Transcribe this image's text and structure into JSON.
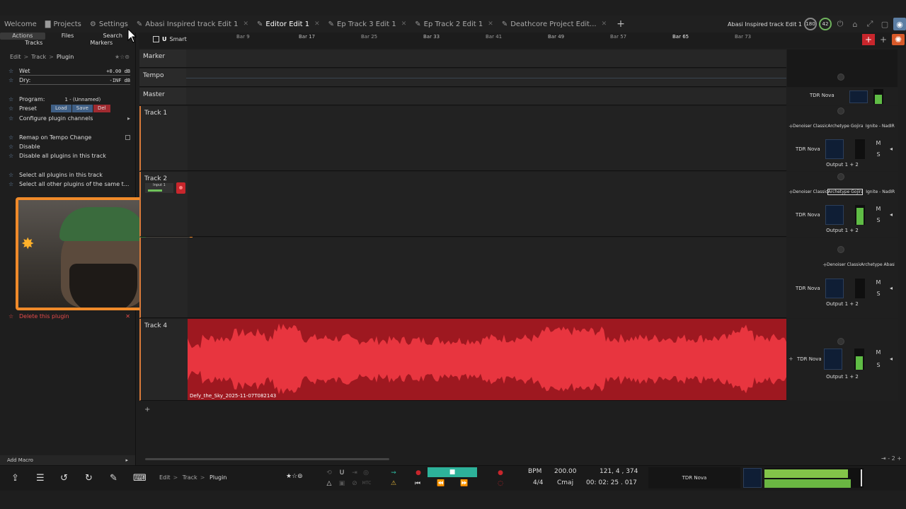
{
  "tabs": [
    {
      "label": "Welcome",
      "icon": "",
      "active": false
    },
    {
      "label": "Projects",
      "icon": "folder-icon",
      "active": false
    },
    {
      "label": "Settings",
      "icon": "gear-icon",
      "active": false
    },
    {
      "label": "Abasi Inspired track Edit 1",
      "icon": "edit-icon",
      "active": false
    },
    {
      "label": "Editor Edit 1",
      "icon": "edit-icon",
      "active": true
    },
    {
      "label": "Ep Track 3 Edit 1",
      "icon": "edit-icon",
      "active": false
    },
    {
      "label": "Ep Track 2 Edit 1",
      "icon": "edit-icon",
      "active": false
    },
    {
      "label": "Deathcore Project Edit...",
      "icon": "edit-icon",
      "active": false
    }
  ],
  "title_right": {
    "project": "Abasi Inspired track Edit 1",
    "ring1": "180",
    "ring2": "42"
  },
  "left_panel": {
    "tabs_row1": [
      "Actions",
      "Files",
      "Search"
    ],
    "tabs_row2": [
      "Tracks",
      "Markers"
    ],
    "breadcrumb": [
      "Edit",
      "Track",
      "Plugin"
    ],
    "wet_label": "Wet",
    "wet_value": "+0.00 dB",
    "dry_label": "Dry:",
    "dry_value": "-INF dB",
    "program_label": "Program:",
    "program_value": "1 - (Unnamed)",
    "preset_label": "Preset",
    "load": "Load",
    "save": "Save",
    "del": "Del",
    "configure": "Configure plugin channels",
    "remap": "Remap on Tempo Change",
    "disable": "Disable",
    "disable_all": "Disable all plugins in this track",
    "select_all": "Select all plugins in this track",
    "select_other": "Select all other plugins of the same t...",
    "delete": "Delete this plugin",
    "add_macro": "Add Macro"
  },
  "ruler": {
    "smart": "Smart",
    "bars": [
      "Bar 9",
      "Bar 17",
      "Bar 25",
      "Bar 33",
      "Bar 41",
      "Bar 49",
      "Bar 57",
      "Bar 65",
      "Bar 73"
    ]
  },
  "tracks": {
    "marker": "Marker",
    "tempo": "Tempo",
    "master": "Master",
    "track1": "Track 1",
    "track2": "Track 2",
    "track2_input": "Input 1",
    "track4": "Track 4",
    "clip_name": "Defy_the_Sky_2025-11-07T082143"
  },
  "mixer": {
    "master_plugin": "TDR Nova",
    "t1_plugins": [
      "Denoiser Classic",
      "Archetype Gojira",
      "Ignite - NadIR"
    ],
    "t2_plugins": [
      "Denoiser Classic",
      "Archetype Gojira",
      "Ignite - NadIR"
    ],
    "t3_plugins": [
      "Denoiser Classic",
      "Archetype Abasi"
    ],
    "nova": "TDR Nova",
    "output": "Output 1 + 2",
    "m": "M",
    "s": "S"
  },
  "transport": {
    "breadcrumb": [
      "Edit",
      "Track",
      "Plugin"
    ],
    "bpm_label": "BPM",
    "bpm_value": "200.00",
    "sig": "4/4",
    "key": "Cmaj",
    "position": "121, 4 , 374",
    "time": "00: 02: 25 . 017",
    "plugin": "TDR Nova",
    "zoom": "2"
  }
}
